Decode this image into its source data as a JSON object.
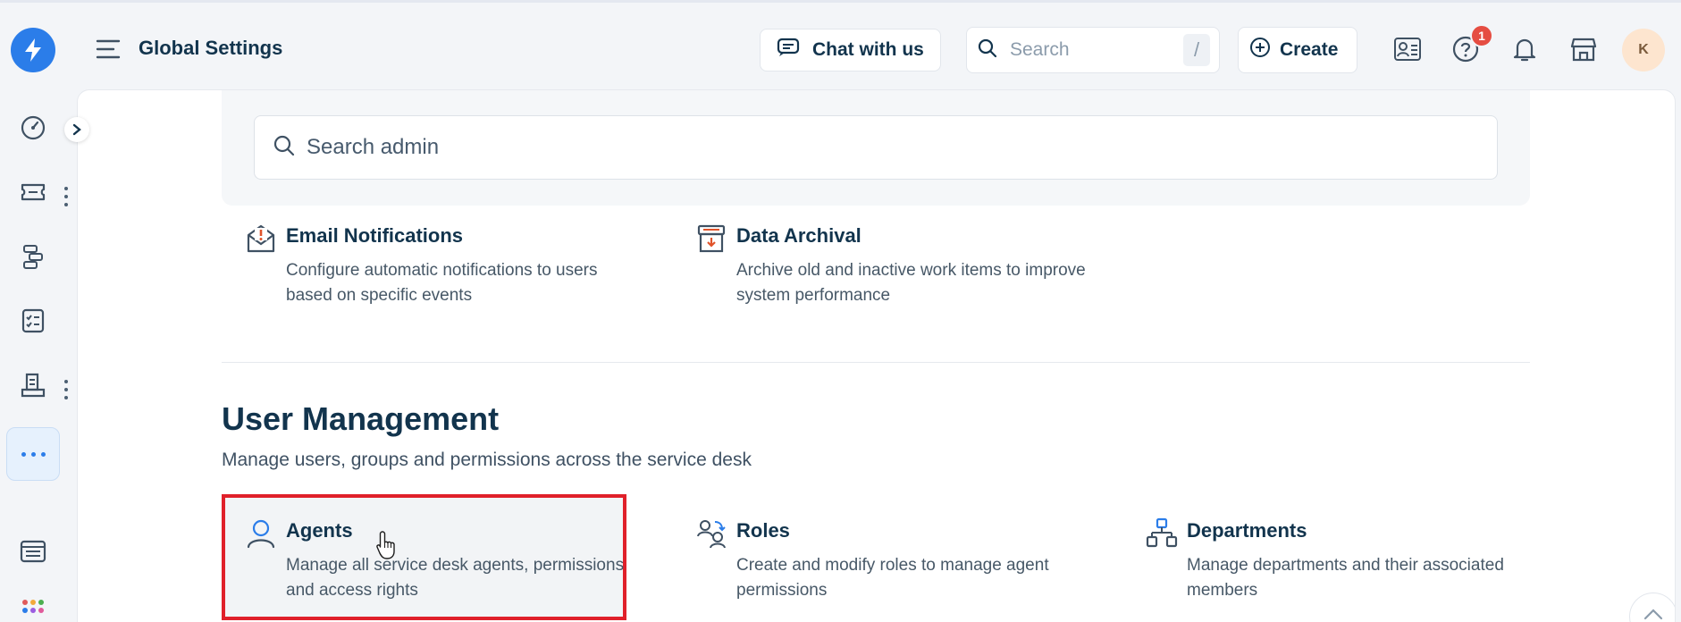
{
  "header": {
    "title": "Global Settings",
    "chat_label": "Chat with us",
    "search_placeholder": "Search",
    "search_shortcut": "/",
    "create_label": "Create",
    "help_badge_count": "1",
    "avatar_initial": "K"
  },
  "admin": {
    "search_placeholder": "Search admin"
  },
  "cards_top": [
    {
      "title": "Email Notifications",
      "description": "Configure automatic notifications to users based on specific events",
      "icon": "email-alert-icon"
    },
    {
      "title": "Data Archival",
      "description": "Archive old and inactive work items to improve system performance",
      "icon": "archive-icon"
    }
  ],
  "user_management": {
    "title": "User Management",
    "description": "Manage users, groups and permissions across the service desk",
    "cards": [
      {
        "title": "Agents",
        "description": "Manage all service desk agents, permissions and access rights",
        "icon": "agent-icon",
        "highlighted": true
      },
      {
        "title": "Roles",
        "description": "Create and modify roles to manage agent permissions",
        "icon": "roles-icon"
      },
      {
        "title": "Departments",
        "description": "Manage departments and their associated members",
        "icon": "departments-icon"
      }
    ]
  },
  "colors": {
    "brand": "#2b7de9",
    "text": "#12344d",
    "highlight": "#e0202a",
    "badge": "#e54d42"
  }
}
